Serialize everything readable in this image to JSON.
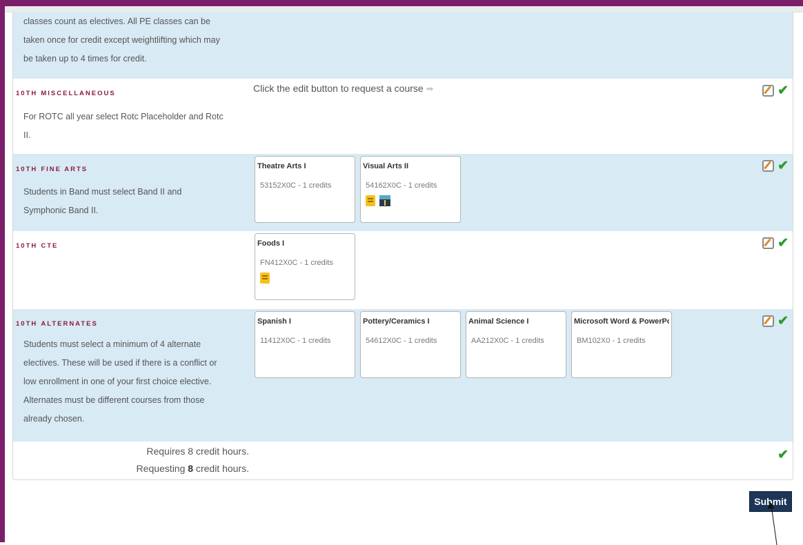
{
  "rows": {
    "pe": {
      "desc": [
        "classes count as electives. All PE classes can be",
        "taken once for credit except weightlifting which may",
        "be taken up to 4 times for credit."
      ]
    },
    "misc": {
      "title_prefix": "10TH",
      "title_rest": "Miscellaneous",
      "desc": [
        "For ROTC all year select Rotc Placeholder and Rotc",
        "II."
      ],
      "hint": "Click the edit button to request a course"
    },
    "fine_arts": {
      "title_prefix": "10TH",
      "title_rest": "Fine Arts",
      "desc": [
        "Students in Band must select Band II and",
        "Symphonic Band II."
      ],
      "courses": [
        {
          "name": "Theatre Arts I",
          "code": "53152X0C - 1 credits"
        },
        {
          "name": "Visual Arts II",
          "code": "54162X0C - 1 credits"
        }
      ]
    },
    "cte": {
      "title_prefix": "10TH",
      "title_rest": "CTE",
      "courses": [
        {
          "name": "Foods I",
          "code": "FN412X0C - 1 credits"
        }
      ]
    },
    "alternates": {
      "title_prefix": "10TH",
      "title_rest": "Alternates",
      "desc": [
        "Students must select a minimum of 4 alternate",
        "electives. These will be used if there is a conflict or",
        "low enrollment in one of your first choice elective.",
        "Alternates must be different courses from those",
        "already chosen."
      ],
      "courses": [
        {
          "name": "Spanish I",
          "code": "11412X0C - 1 credits"
        },
        {
          "name": "Pottery/Ceramics I",
          "code": "54612X0C - 1 credits"
        },
        {
          "name": "Animal Science I",
          "code": "AA212X0C - 1 credits"
        },
        {
          "name": "Microsoft Word & PowerPo",
          "code": "BM102X0 - 1 credits"
        }
      ]
    }
  },
  "summary": {
    "requires": "Requires 8 credit hours.",
    "requesting_prefix": "Requesting",
    "requesting_value": "8",
    "requesting_suffix": "credit hours."
  },
  "submit_label": "Submit",
  "colors": {
    "frame": "#7b1f6a",
    "row_blue": "#d8eaf4",
    "category_title": "#8b1a3d",
    "check": "#2e9b2e",
    "submit_bg": "#1d3557"
  },
  "icons": {
    "edit": "edit-pencil-icon",
    "check": "checkmark-icon",
    "note": "note-icon",
    "image": "road-image-icon",
    "hint_arrow": "arrow-right-icon"
  }
}
